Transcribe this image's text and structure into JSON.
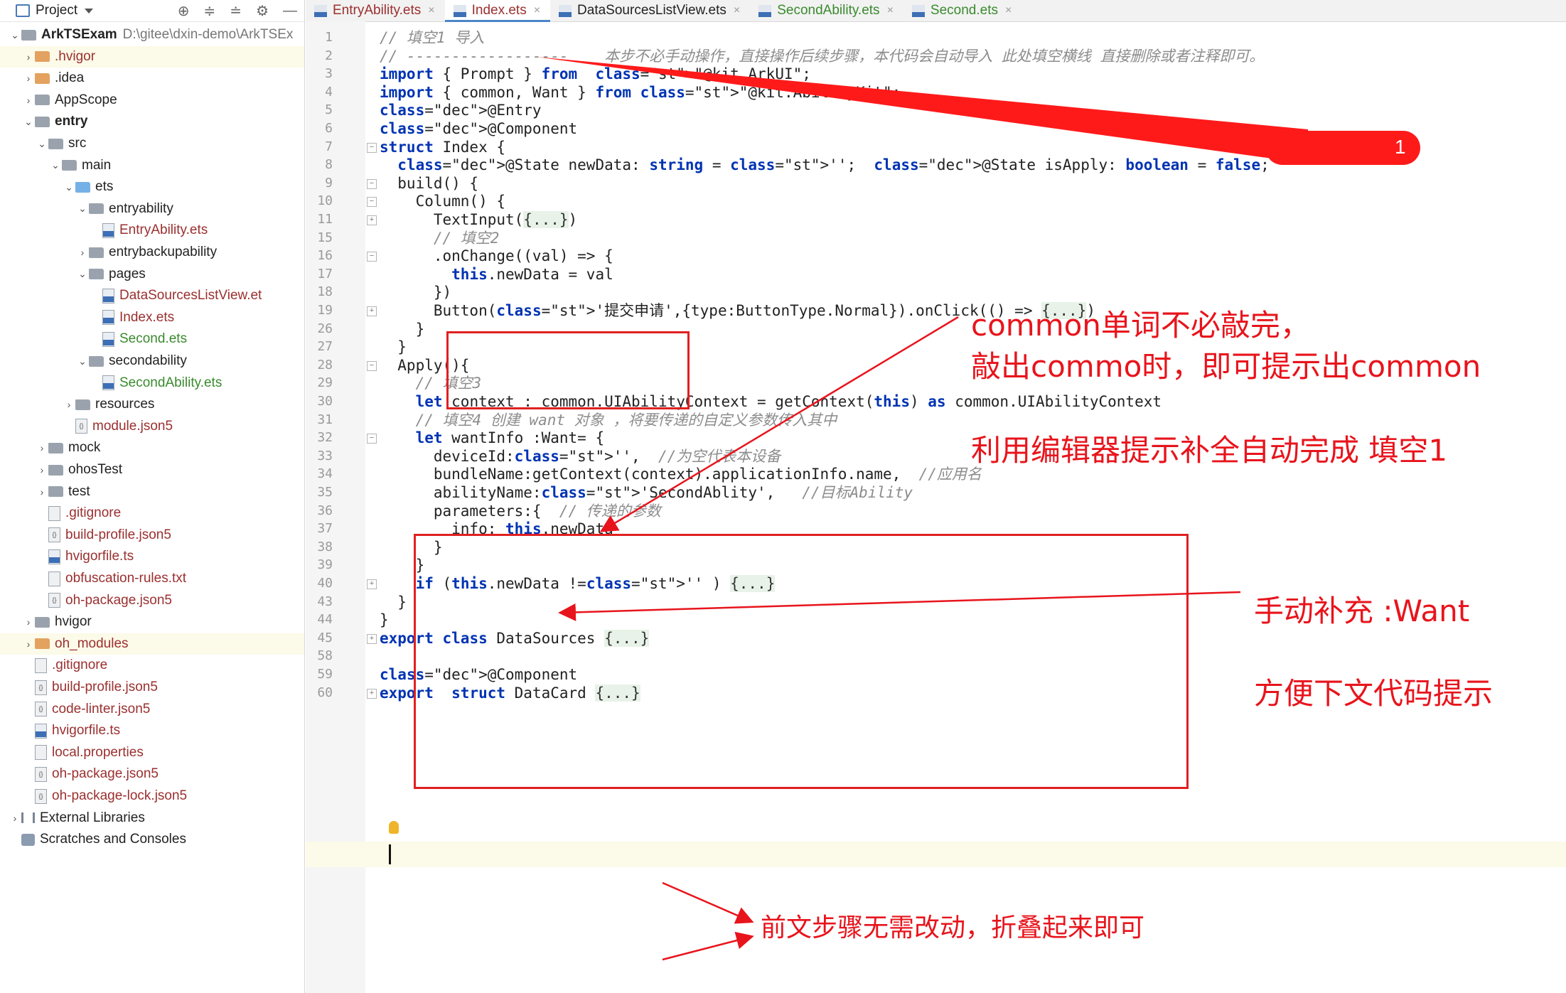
{
  "sidebar": {
    "title": "Project",
    "tool_icons": [
      "target-icon",
      "collapse-icon",
      "expand-icon",
      "gear-icon",
      "minimize-icon"
    ],
    "items": [
      {
        "label": "ArkTSExam",
        "path": "D:\\gitee\\dxin-demo\\ArkTSEx",
        "expanded": true,
        "icon": "folder-icon"
      },
      {
        "label": ".hvigor",
        "expanded": false,
        "icon": "folder-icon"
      },
      {
        "label": ".idea",
        "expanded": false,
        "icon": "folder-icon"
      },
      {
        "label": "AppScope",
        "expanded": false,
        "icon": "folder-icon"
      },
      {
        "label": "entry",
        "expanded": true,
        "icon": "folder-icon"
      },
      {
        "label": "src",
        "expanded": true,
        "icon": "folder-icon"
      },
      {
        "label": "main",
        "expanded": true,
        "icon": "folder-icon"
      },
      {
        "label": "ets",
        "expanded": true,
        "icon": "folder-icon"
      },
      {
        "label": "entryability",
        "expanded": true,
        "icon": "folder-icon"
      },
      {
        "label": "EntryAbility.ets",
        "icon": "ets-file-icon"
      },
      {
        "label": "entrybackupability",
        "expanded": false,
        "icon": "folder-icon"
      },
      {
        "label": "pages",
        "expanded": true,
        "icon": "folder-icon"
      },
      {
        "label": "DataSourcesListView.et",
        "icon": "ets-file-icon"
      },
      {
        "label": "Index.ets",
        "icon": "ets-file-icon"
      },
      {
        "label": "Second.ets",
        "icon": "ets-file-icon"
      },
      {
        "label": "secondability",
        "expanded": true,
        "icon": "folder-icon"
      },
      {
        "label": "SecondAbility.ets",
        "icon": "ets-file-icon"
      },
      {
        "label": "resources",
        "expanded": false,
        "icon": "folder-icon"
      },
      {
        "label": "module.json5",
        "icon": "json-file-icon"
      },
      {
        "label": "mock",
        "expanded": false,
        "icon": "folder-icon"
      },
      {
        "label": "ohosTest",
        "expanded": false,
        "icon": "folder-icon"
      },
      {
        "label": "test",
        "expanded": false,
        "icon": "folder-icon"
      },
      {
        "label": ".gitignore",
        "icon": "gitignore-icon"
      },
      {
        "label": "build-profile.json5",
        "icon": "json-file-icon"
      },
      {
        "label": "hvigorfile.ts",
        "icon": "ts-file-icon"
      },
      {
        "label": "obfuscation-rules.txt",
        "icon": "text-file-icon"
      },
      {
        "label": "oh-package.json5",
        "icon": "json-file-icon"
      },
      {
        "label": "hvigor",
        "expanded": false,
        "icon": "folder-icon"
      },
      {
        "label": "oh_modules",
        "expanded": false,
        "icon": "folder-icon"
      },
      {
        "label": ".gitignore",
        "icon": "gitignore-icon"
      },
      {
        "label": "build-profile.json5",
        "icon": "json-file-icon"
      },
      {
        "label": "code-linter.json5",
        "icon": "json-file-icon"
      },
      {
        "label": "hvigorfile.ts",
        "icon": "ts-file-icon"
      },
      {
        "label": "local.properties",
        "icon": "properties-file-icon"
      },
      {
        "label": "oh-package.json5",
        "icon": "json-file-icon"
      },
      {
        "label": "oh-package-lock.json5",
        "icon": "json-file-icon"
      },
      {
        "label": "External Libraries",
        "expanded": false,
        "icon": "libraries-icon"
      },
      {
        "label": "Scratches and Consoles",
        "icon": "scratches-icon"
      }
    ]
  },
  "tabs": [
    {
      "label": "EntryAbility.ets",
      "active": false
    },
    {
      "label": "Index.ets",
      "active": true
    },
    {
      "label": "DataSourcesListView.ets",
      "active": false
    },
    {
      "label": "SecondAbility.ets",
      "active": false
    },
    {
      "label": "Second.ets",
      "active": false
    }
  ],
  "editor": {
    "lines": [
      {
        "num": "1",
        "code": "// 填空1 导入"
      },
      {
        "num": "2",
        "code": "// ------------------    本步不必手动操作，直接操作后续步骤，本代码会自动导入 此处填空横线 直接删除或者注释即可。"
      },
      {
        "num": "3",
        "code": "import { Prompt } from  \"@kit.ArkUI\";"
      },
      {
        "num": "4",
        "code": "import { common, Want } from \"@kit.AbilityKit\";"
      },
      {
        "num": "5",
        "code": "@Entry"
      },
      {
        "num": "6",
        "code": "@Component"
      },
      {
        "num": "7",
        "code": "struct Index {"
      },
      {
        "num": "8",
        "code": "  @State newData: string = '';  @State isApply: boolean = false;"
      },
      {
        "num": "9",
        "code": "  build() {"
      },
      {
        "num": "10",
        "code": "    Column() {"
      },
      {
        "num": "11",
        "code": "      TextInput({...})"
      },
      {
        "num": "15",
        "code": "      // 填空2"
      },
      {
        "num": "16",
        "code": "      .onChange((val) => {"
      },
      {
        "num": "17",
        "code": "        this.newData = val"
      },
      {
        "num": "18",
        "code": "      })"
      },
      {
        "num": "19",
        "code": "      Button('提交申请',{type:ButtonType.Normal}).onClick(() => {...})"
      },
      {
        "num": "26",
        "code": "    }"
      },
      {
        "num": "27",
        "code": "  }"
      },
      {
        "num": "28",
        "code": "  Apply(){"
      },
      {
        "num": "29",
        "code": "    // 填空3"
      },
      {
        "num": "30",
        "code": "    let context : common.UIAbilityContext = getContext(this) as common.UIAbilityContext"
      },
      {
        "num": "31",
        "code": "    // 填空4 创建 want 对象 ，将要传递的自定义参数传入其中"
      },
      {
        "num": "32",
        "code": "    let wantInfo :Want= {"
      },
      {
        "num": "33",
        "code": "      deviceId:'',  //为空代表本设备"
      },
      {
        "num": "34",
        "code": "      bundleName:getContext(context).applicationInfo.name,  //应用名"
      },
      {
        "num": "35",
        "code": "      abilityName:'SecondAblity',   //目标Ability"
      },
      {
        "num": "36",
        "code": "      parameters:{  // 传递的参数"
      },
      {
        "num": "37",
        "code": "        info: this.newData"
      },
      {
        "num": "38",
        "code": "      }"
      },
      {
        "num": "39",
        "code": "    }"
      },
      {
        "num": "40",
        "code": "    if (this.newData !='' ) {...}"
      },
      {
        "num": "43",
        "code": "  }"
      },
      {
        "num": "44",
        "code": "}"
      },
      {
        "num": "45",
        "code": "export class DataSources {...}"
      },
      {
        "num": "58",
        "code": ""
      },
      {
        "num": "59",
        "code": "@Component"
      },
      {
        "num": "60",
        "code": "export  struct DataCard {...}"
      }
    ]
  },
  "annotations": {
    "badge": "1",
    "common_tip_line1": "common单词不必敲完，",
    "common_tip_line2": "敲出commo时，即可提示出common",
    "autocomplete_tip": "利用编辑器提示补全自动完成 填空1",
    "want_tip": "手动补充 :Want",
    "hint_tip": "方便下文代码提示",
    "fold_tip": "前文步骤无需改动，折叠起来即可",
    "accent_color": "#e8141c"
  }
}
